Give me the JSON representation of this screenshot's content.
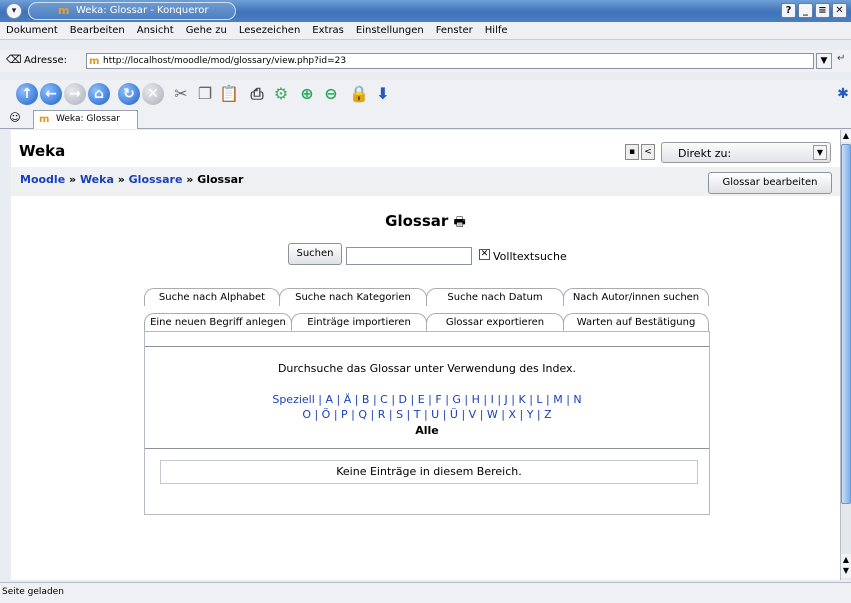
{
  "window": {
    "title": "Weka: Glossar - Konqueror",
    "buttons": [
      "?",
      "_",
      "≡",
      "✕"
    ]
  },
  "menu": {
    "items": [
      "Dokument",
      "Bearbeiten",
      "Ansicht",
      "Gehe zu",
      "Lesezeichen",
      "Extras",
      "Einstellungen",
      "Fenster",
      "Hilfe"
    ]
  },
  "location": {
    "label": "Adresse:",
    "url": "http://localhost/moodle/mod/glossary/view.php?id=23"
  },
  "browser_tab": {
    "title": "Weka: Glossar"
  },
  "page": {
    "site_name": "Weka",
    "jump_label": "Direkt zu:",
    "breadcrumb": {
      "moodle": "Moodle",
      "sep": " » ",
      "weka": "Weka",
      "glossare": "Glossare",
      "current": "Glossar"
    },
    "edit_button": "Glossar bearbeiten",
    "heading": "Glossar",
    "search_button": "Suchen",
    "search_value": "",
    "fulltext_label": "Volltextsuche",
    "tabs_row1": [
      "Suche nach Alphabet",
      "Suche nach Kategorien",
      "Suche nach Datum",
      "Nach Autor/innen suchen"
    ],
    "tabs_row2": [
      "Eine neuen Begriff anlegen",
      "Einträge importieren",
      "Glossar exportieren",
      "Warten auf Bestätigung"
    ],
    "browse_text": "Durchsuche das Glossar unter Verwendung des Index.",
    "letters_line1": "Speziell | A | Ä | B | C | D | E | F | G | H | I | J | K | L | M | N",
    "letters_line2": "O | Ö | P | Q | R | S | T | U | Ü | V | W | X | Y | Z",
    "all_label": "Alle",
    "empty_message": "Keine Einträge in diesem Bereich."
  },
  "status": {
    "text": "Seite geladen"
  }
}
